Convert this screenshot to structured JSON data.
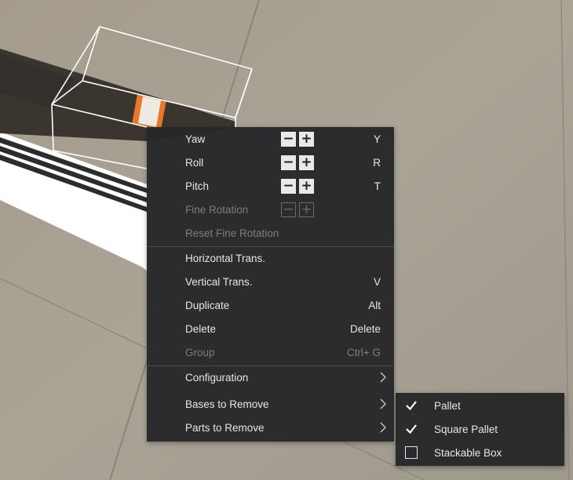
{
  "menu": {
    "rotation_items": [
      {
        "label": "Yaw",
        "shortcut": "Y"
      },
      {
        "label": "Roll",
        "shortcut": "R"
      },
      {
        "label": "Pitch",
        "shortcut": "T"
      },
      {
        "label": "Fine Rotation",
        "shortcut": ""
      }
    ],
    "stepper": {
      "minus": "−",
      "plus": "+"
    },
    "reset_fine_rotation": "Reset Fine Rotation",
    "horizontal_trans": {
      "label": "Horizontal Trans.",
      "shortcut": ""
    },
    "vertical_trans": {
      "label": "Vertical Trans.",
      "shortcut": "V"
    },
    "duplicate": {
      "label": "Duplicate",
      "shortcut": "Alt"
    },
    "delete": {
      "label": "Delete",
      "shortcut": "Delete"
    },
    "group": {
      "label": "Group",
      "shortcut": "Ctrl+ G"
    },
    "configuration": "Configuration",
    "bases_to_remove": "Bases to Remove",
    "parts_to_remove": "Parts to Remove"
  },
  "submenu": {
    "items": [
      {
        "label": "Pallet",
        "checked": true
      },
      {
        "label": "Square Pallet",
        "checked": true
      },
      {
        "label": "Stackable Box",
        "checked": false
      }
    ]
  },
  "colors": {
    "menu_bg": "#262629",
    "text": "#e6e6e6",
    "disabled_text": "#7d7d80",
    "accent_orange": "#e8772a",
    "floor": "#a59e92"
  }
}
